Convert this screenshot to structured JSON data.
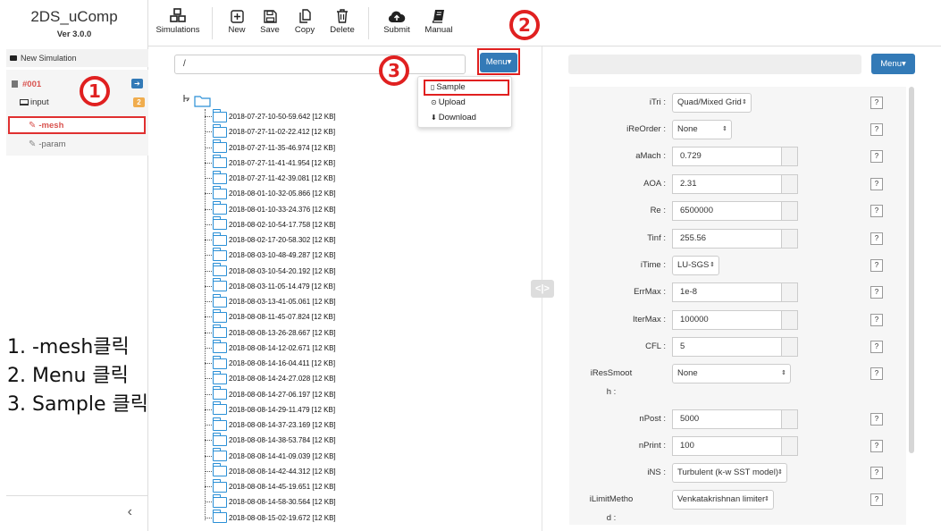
{
  "app": {
    "title": "2DS_uComp",
    "version": "Ver 3.0.0"
  },
  "toolbar": {
    "simulations": "Simulations",
    "new": "New",
    "save": "Save",
    "copy": "Copy",
    "delete": "Delete",
    "submit": "Submit",
    "manual": "Manual"
  },
  "sidebar": {
    "new_simulation": "New Simulation",
    "sim_id": "#001",
    "sim_badge": "➔",
    "input_label": "input",
    "input_badge": "2",
    "mesh_label": "-mesh",
    "param_label": "-param",
    "collapse": "‹"
  },
  "instructions": [
    "1. -mesh클릭",
    "2. Menu 클릭",
    "3. Sample 클릭"
  ],
  "annotations": [
    "1",
    "2",
    "3"
  ],
  "file_panel": {
    "path": "/",
    "menu_label": "Menu▾",
    "dropdown": {
      "sample": "Sample",
      "upload": "Upload",
      "download": "Download"
    },
    "files": [
      "2018-07-27-10-50-59.642 [12 KB]",
      "2018-07-27-11-02-22.412 [12 KB]",
      "2018-07-27-11-35-46.974 [12 KB]",
      "2018-07-27-11-41-41.954 [12 KB]",
      "2018-07-27-11-42-39.081 [12 KB]",
      "2018-08-01-10-32-05.866 [12 KB]",
      "2018-08-01-10-33-24.376 [12 KB]",
      "2018-08-02-10-54-17.758 [12 KB]",
      "2018-08-02-17-20-58.302 [12 KB]",
      "2018-08-03-10-48-49.287 [12 KB]",
      "2018-08-03-10-54-20.192 [12 KB]",
      "2018-08-03-11-05-14.479 [12 KB]",
      "2018-08-03-13-41-05.061 [12 KB]",
      "2018-08-08-11-45-07.824 [12 KB]",
      "2018-08-08-13-26-28.667 [12 KB]",
      "2018-08-08-14-12-02.671 [12 KB]",
      "2018-08-08-14-16-04.411 [12 KB]",
      "2018-08-08-14-24-27.028 [12 KB]",
      "2018-08-08-14-27-06.197 [12 KB]",
      "2018-08-08-14-29-11.479 [12 KB]",
      "2018-08-08-14-37-23.169 [12 KB]",
      "2018-08-08-14-38-53.784 [12 KB]",
      "2018-08-08-14-41-09.039 [12 KB]",
      "2018-08-08-14-42-44.312 [12 KB]",
      "2018-08-08-14-45-19.651 [12 KB]",
      "2018-08-08-14-58-30.564 [12 KB]",
      "2018-08-08-15-02-19.672 [12 KB]"
    ]
  },
  "splitter": "<|>",
  "param_panel": {
    "menu_label": "Menu▾",
    "help": "?",
    "rows": [
      {
        "label": "iTri :",
        "type": "select",
        "value": "Quad/Mixed Grid"
      },
      {
        "label": "iReOrder :",
        "type": "select",
        "value": "None"
      },
      {
        "label": "aMach :",
        "type": "input",
        "value": "0.729"
      },
      {
        "label": "AOA :",
        "type": "input",
        "value": "2.31"
      },
      {
        "label": "Re :",
        "type": "input",
        "value": "6500000"
      },
      {
        "label": "Tinf :",
        "type": "input",
        "value": "255.56"
      },
      {
        "label": "iTime :",
        "type": "select",
        "value": "LU-SGS"
      },
      {
        "label": "ErrMax :",
        "type": "input",
        "value": "1e-8"
      },
      {
        "label": "IterMax :",
        "type": "input",
        "value": "100000"
      },
      {
        "label": "CFL :",
        "type": "input",
        "value": "5"
      },
      {
        "label": "iResSmooth :",
        "label_lines": [
          "iResSmoot",
          "h :"
        ],
        "type": "select",
        "value": "None"
      },
      {
        "label": "nPost :",
        "type": "input",
        "value": "5000"
      },
      {
        "label": "nPrint :",
        "type": "input",
        "value": "100"
      },
      {
        "label": "iNS :",
        "type": "select",
        "value": "Turbulent (k-w SST model)"
      },
      {
        "label": "iLimitMethod :",
        "label_lines": [
          "iLimitMetho",
          "d :"
        ],
        "type": "select",
        "value": "Venkatakrishnan limiter"
      }
    ]
  },
  "colors": {
    "accent": "#337ab7",
    "annotation_red": "#e02020",
    "mesh_red": "#d9534f"
  }
}
